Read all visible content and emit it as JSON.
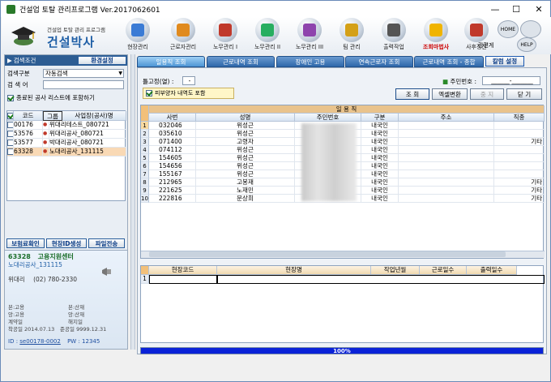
{
  "window": {
    "title": "건설업 토탈 관리프로그램  Ver.2017062601"
  },
  "logo": {
    "subtitle": "건설업 토탈 관리 프로그램",
    "name": "건설박사"
  },
  "nav": [
    {
      "label": "현장관리",
      "icon": "building-icon",
      "color": "#3a7bd5"
    },
    {
      "label": "근로자관리",
      "icon": "worker-icon",
      "color": "#e08a1e"
    },
    {
      "label": "노무관리 I",
      "icon": "book-icon",
      "color": "#c0392b"
    },
    {
      "label": "노무관리 II",
      "icon": "book-icon",
      "color": "#27ae60"
    },
    {
      "label": "노무관리 III",
      "icon": "book-icon",
      "color": "#8e44ad"
    },
    {
      "label": "팀 관리",
      "icon": "folder-icon",
      "color": "#d4a017"
    },
    {
      "label": "출력작업",
      "icon": "printer-icon",
      "color": "#555555"
    },
    {
      "label": "조회마법사",
      "icon": "magic-wand-icon",
      "color": "#f0b400"
    },
    {
      "label": "사후정산",
      "icon": "settlement-icon",
      "color": "#c0392b"
    },
    {
      "label": "간편게",
      "icon": "pen-icon",
      "color": "#666666"
    }
  ],
  "side_buttons": {
    "home": "HOME",
    "help": "HELP"
  },
  "left": {
    "tab_search": "검색조건",
    "env_button": "환경설정",
    "search_type_label": "검색구분",
    "search_type_value": "자동검색",
    "search_word_label": "검 색 어",
    "search_word_value": "",
    "include_finished": "종료된 공사 리스트에 포함하기",
    "list_headers": [
      "코드",
      "그룹",
      "사업장(공사)명"
    ],
    "sites": [
      {
        "code": "00176",
        "name": "위대리테스트_080721",
        "selected": false
      },
      {
        "code": "53576",
        "name": "위대리공사_080721",
        "selected": false
      },
      {
        "code": "53577",
        "name": "박대리공사_080721",
        "selected": false
      },
      {
        "code": "63328",
        "name": "노대리공사_131115",
        "selected": true
      }
    ],
    "btn_insurance": "보험료확인",
    "btn_site_id": "현장ID생성",
    "btn_file_send": "파일전송",
    "info_code": "63328",
    "info_center": "고용지원센터",
    "info_site": "노대리공사_131115",
    "manager": "위대리",
    "phone": "(02) 780-2330",
    "labels": {
      "hq_emp": "본:고용",
      "hq_acc": "본:산재",
      "br_emp": "앙:고용",
      "br_acc": "앙:산재",
      "contract": "계약일",
      "cancel": "해지일",
      "start": "착공일",
      "complete": "준공일"
    },
    "start_date": "2014.07.13",
    "complete_date": "9999.12.31",
    "id_label": "ID",
    "id_value": "se00178-0002",
    "pw_label": "PW",
    "pw_value": "12345"
  },
  "tabs": [
    "일용직 조회",
    "근로내역 조회",
    "장애인 고용",
    "연속근로자 조회",
    "근로내역 조회 - 종합"
  ],
  "column_settings": "칼럼 설정",
  "fixed_cols_label": "틀고정(열) :",
  "fixed_cols_value": "-",
  "resident_label": "주민번호 :",
  "resident_value": "______-_______",
  "show_subject": "피부양자 내역도 포함",
  "buttons": {
    "search": "조 회",
    "excel": "엑셀변환",
    "stop": "중 지",
    "close": "닫 기"
  },
  "grid": {
    "group_header": "일 용 직",
    "headers": [
      "사번",
      "성명",
      "주민번호",
      "구분",
      "주소",
      "직종"
    ],
    "rows": [
      {
        "no": "1",
        "emp": "032046",
        "name": "위성근",
        "type": "내국인",
        "job": ""
      },
      {
        "no": "2",
        "emp": "035610",
        "name": "위성근",
        "type": "내국인",
        "job": ""
      },
      {
        "no": "3",
        "emp": "071400",
        "name": "고령자",
        "type": "내국인",
        "job": "기타"
      },
      {
        "no": "4",
        "emp": "074112",
        "name": "위성근",
        "type": "내국인",
        "job": ""
      },
      {
        "no": "5",
        "emp": "154605",
        "name": "위성근",
        "type": "내국인",
        "job": ""
      },
      {
        "no": "6",
        "emp": "154656",
        "name": "위성근",
        "type": "내국인",
        "job": ""
      },
      {
        "no": "7",
        "emp": "155167",
        "name": "위성근",
        "type": "내국인",
        "job": ""
      },
      {
        "no": "8",
        "emp": "212965",
        "name": "고봉재",
        "type": "내국인",
        "job": "기타"
      },
      {
        "no": "9",
        "emp": "221625",
        "name": "노재민",
        "type": "내국인",
        "job": "기타"
      },
      {
        "no": "10",
        "emp": "222816",
        "name": "문상희",
        "type": "내국인",
        "job": "기타"
      }
    ]
  },
  "subgrid": {
    "headers": [
      "현장코드",
      "현장명",
      "작업년월",
      "근로일수",
      "출력일수"
    ],
    "row_no": "1"
  },
  "progress": {
    "text": "100%",
    "percent": 100
  }
}
